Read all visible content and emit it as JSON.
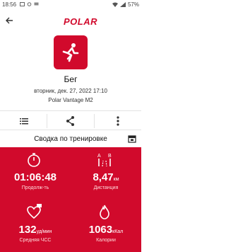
{
  "status": {
    "time": "18:56",
    "battery": "57%"
  },
  "app": {
    "brand": "POLAR"
  },
  "training": {
    "sport": "Бег",
    "datetime": "вторник, дек. 27, 2022 17:10",
    "device": "Polar Vantage M2"
  },
  "summary": {
    "title": "Сводка по тренировке"
  },
  "metrics": {
    "duration": {
      "value": "01:06:48",
      "label": "Продолж-ть"
    },
    "distance": {
      "value": "8,47",
      "unit": "км",
      "label": "Дистанция"
    },
    "heart_rate": {
      "value": "132",
      "unit": "уд/мин",
      "label": "Средняя ЧСС"
    },
    "calories": {
      "value": "1063",
      "unit": "кКал",
      "label": "Калории"
    }
  },
  "colors": {
    "accent": "#d10a2c"
  }
}
